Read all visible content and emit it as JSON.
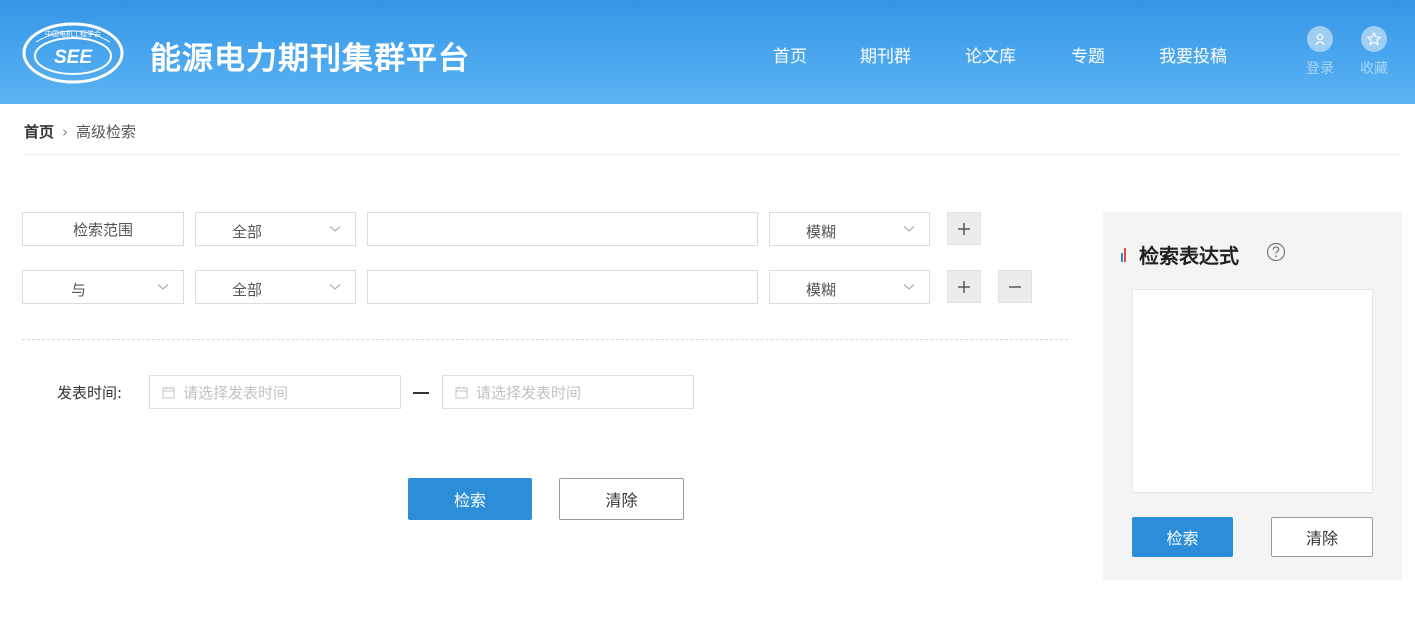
{
  "header": {
    "logo_top_text": "中国电机工程学会",
    "logo_text": "SEE",
    "site_title": "能源电力期刊集群平台",
    "nav": [
      "首页",
      "期刊群",
      "论文库",
      "专题",
      "我要投稿"
    ],
    "login_label": "登录",
    "favorites_label": "收藏"
  },
  "breadcrumb": {
    "home": "首页",
    "current": "高级检索"
  },
  "search": {
    "rows": [
      {
        "logic": "检索范围",
        "field": "全部",
        "keyword": "",
        "match": "模糊"
      },
      {
        "logic": "与",
        "field": "全部",
        "keyword": "",
        "match": "模糊"
      }
    ],
    "date_label": "发表时间:",
    "date_start_placeholder": "请选择发表时间",
    "date_end_placeholder": "请选择发表时间",
    "search_button": "检索",
    "clear_button": "清除"
  },
  "expression_panel": {
    "title": "检索表达式",
    "expression": "",
    "search_button": "检索",
    "clear_button": "清除"
  },
  "colors": {
    "header_blue": "#3596e6",
    "primary_button": "#2c8ed8",
    "panel_background": "#f4f4f4"
  }
}
